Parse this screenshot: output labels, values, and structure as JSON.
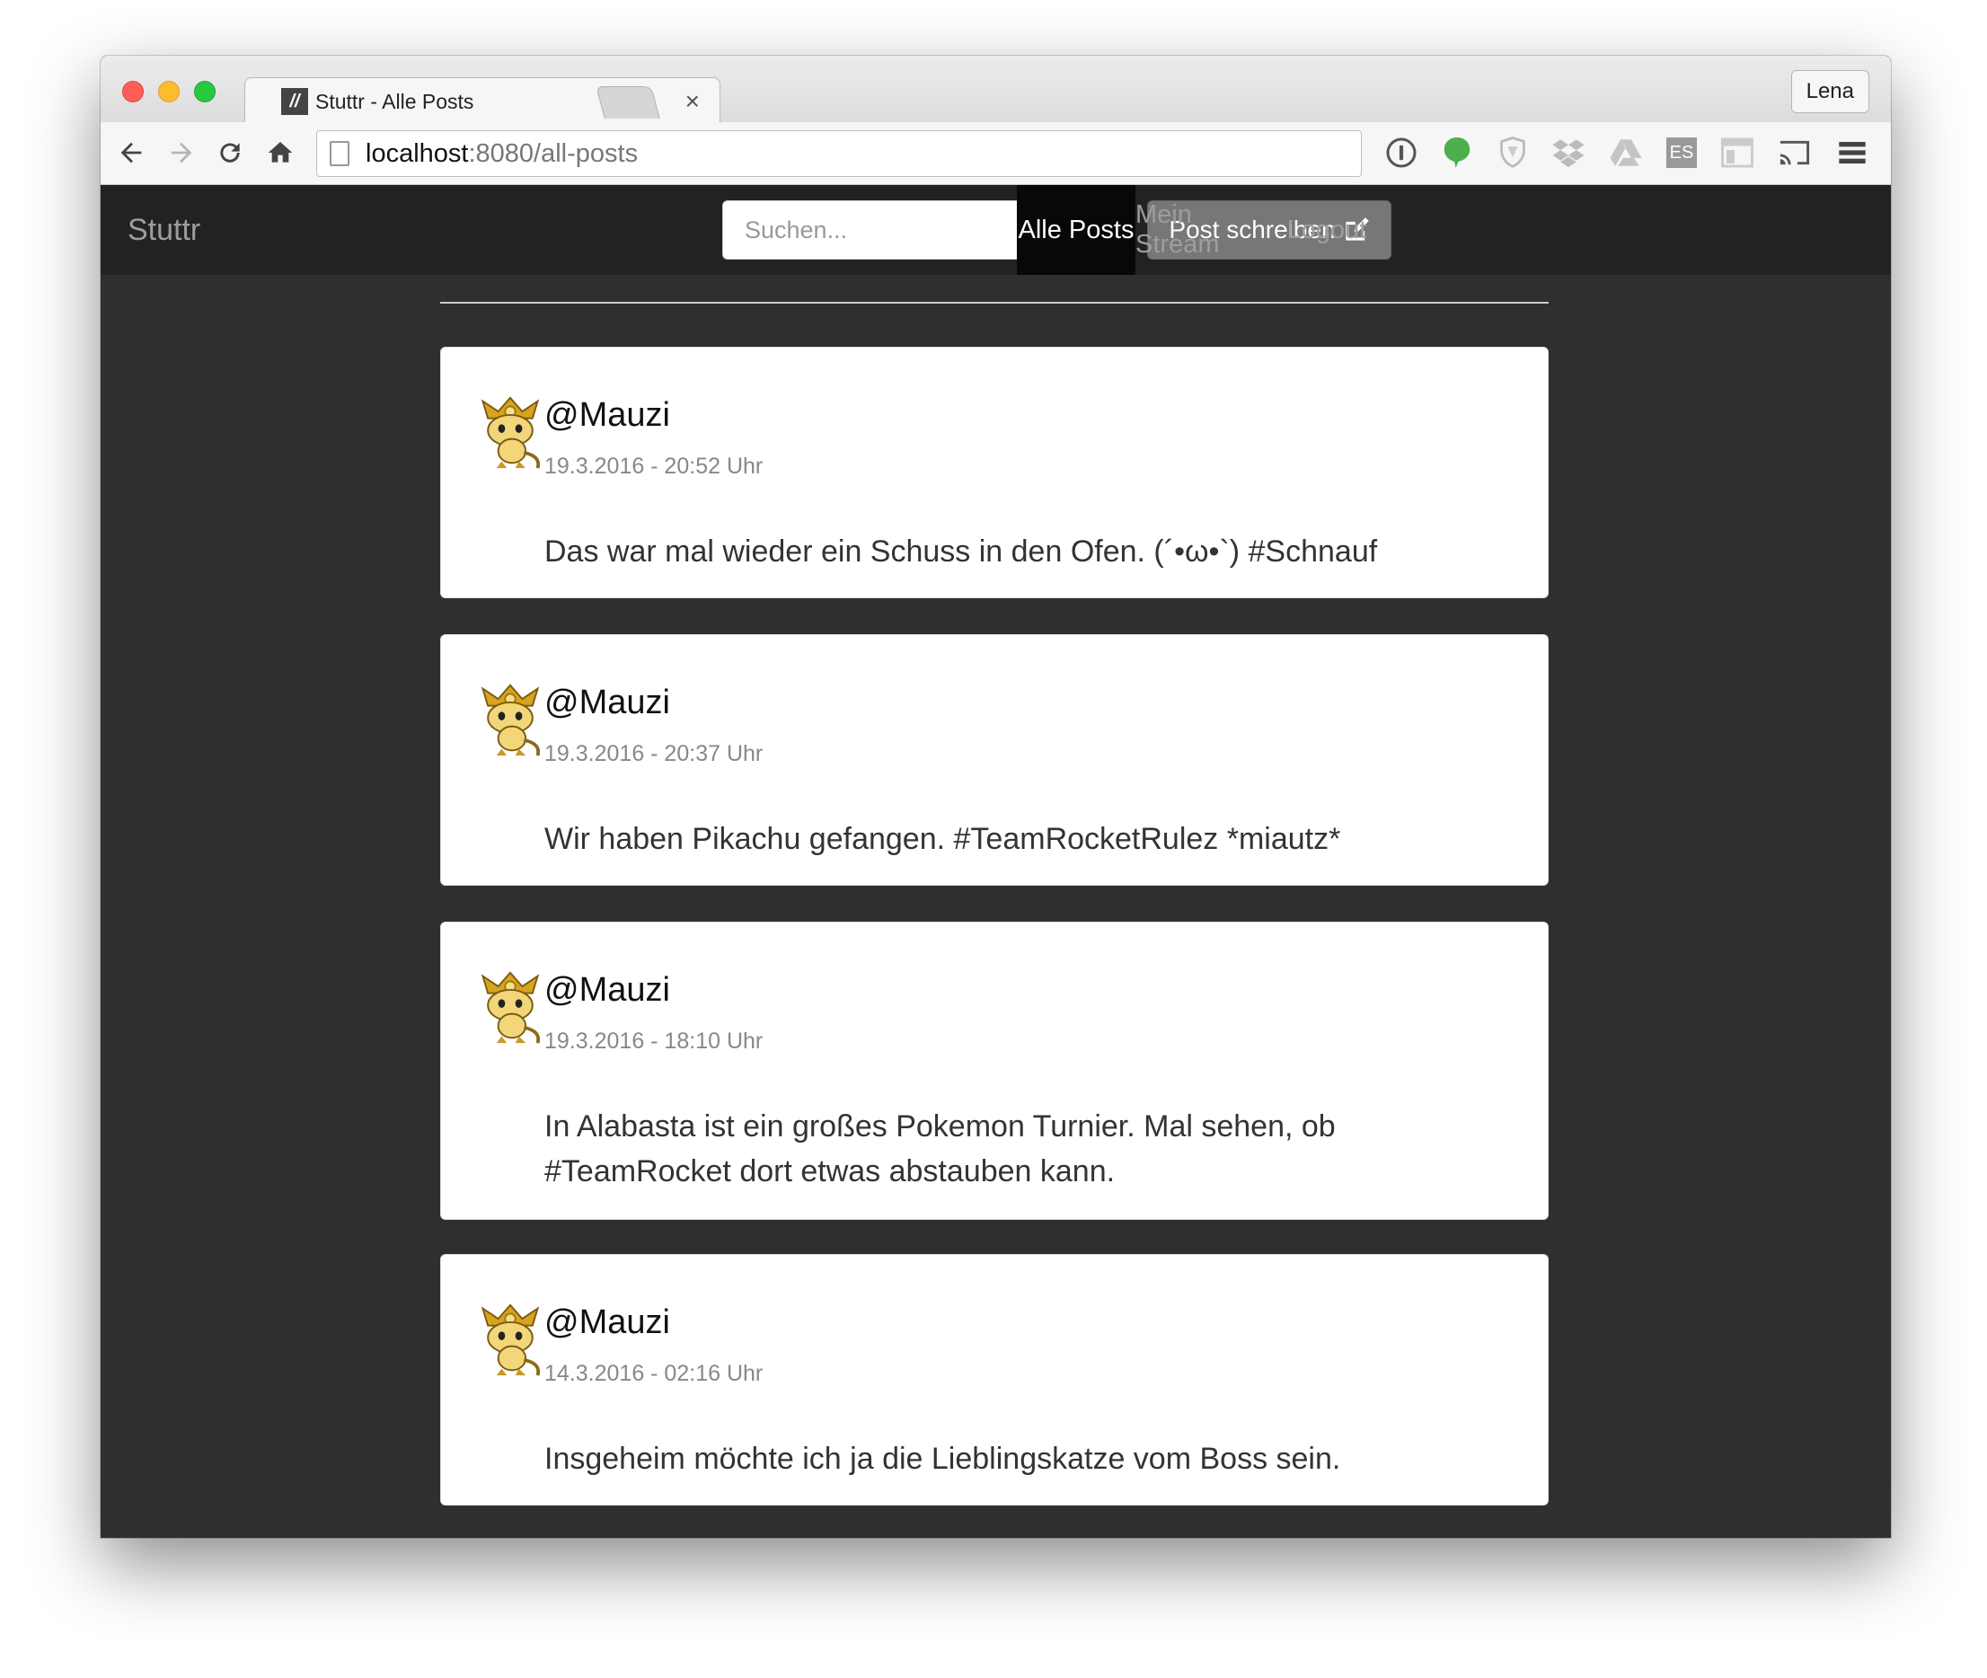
{
  "browser": {
    "tab_title": "Stuttr - Alle Posts",
    "tab_favicon": "//",
    "profile_name": "Lena",
    "url_host": "localhost",
    "url_rest": ":8080/all-posts",
    "icons": [
      "back-icon",
      "forward-icon",
      "reload-icon",
      "home-icon",
      "onepassword-icon",
      "evernote-icon",
      "shield-icon",
      "dropbox-icon",
      "drive-icon",
      "es-icon",
      "layout-icon",
      "cast-icon",
      "menu-icon"
    ],
    "es_label": "ES"
  },
  "navbar": {
    "brand": "Stuttr",
    "search_placeholder": "Suchen...",
    "write_post_label": "Post schreiben",
    "items": [
      {
        "label": "Alle Posts",
        "active": true
      },
      {
        "label": "Mein Stream",
        "active": false
      },
      {
        "label": "Logout",
        "active": false
      }
    ]
  },
  "posts": [
    {
      "user": "@Mauzi",
      "date": "19.3.2016 - 20:52 Uhr",
      "text": "Das war mal wieder ein Schuss in den Ofen. (´•ω•`) #Schnauf"
    },
    {
      "user": "@Mauzi",
      "date": "19.3.2016 - 20:37 Uhr",
      "text": "Wir haben Pikachu gefangen. #TeamRocketRulez *miautz*"
    },
    {
      "user": "@Mauzi",
      "date": "19.3.2016 - 18:10 Uhr",
      "text": "In Alabasta ist ein großes Pokemon Turnier. Mal sehen, ob #TeamRocket dort etwas abstauben kann."
    },
    {
      "user": "@Mauzi",
      "date": "14.3.2016 - 02:16 Uhr",
      "text": "Insgeheim möchte ich ja die Lieblingskatze vom Boss sein."
    }
  ]
}
